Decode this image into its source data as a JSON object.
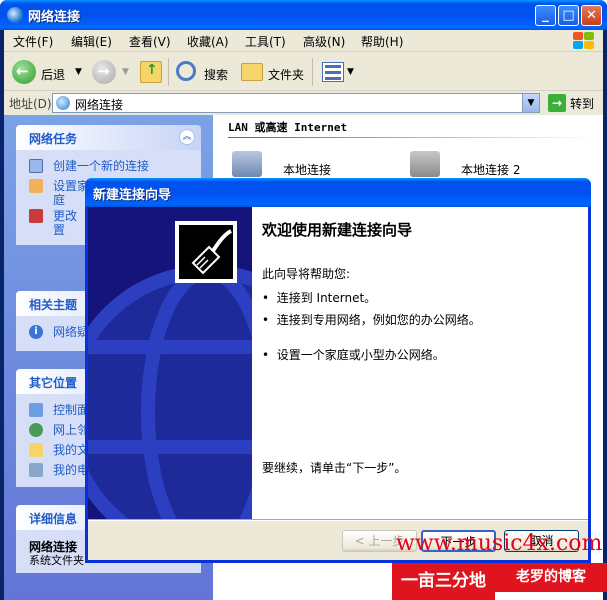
{
  "window": {
    "title": "网络连接"
  },
  "menus": [
    "文件(F)",
    "编辑(E)",
    "查看(V)",
    "收藏(A)",
    "工具(T)",
    "高级(N)",
    "帮助(H)"
  ],
  "toolbar": {
    "back": "后退",
    "search": "搜索",
    "folders": "文件夹"
  },
  "address": {
    "label": "地址(D)",
    "value": "网络连接",
    "go": "转到"
  },
  "section_header": "LAN 或高速 Internet",
  "connections": [
    "本地连接",
    "本地连接 2"
  ],
  "panels": {
    "tasks": {
      "title": "网络任务",
      "items": [
        "创建一个新的连接",
        "设置家",
        "庭",
        "更改",
        "置"
      ]
    },
    "related": {
      "title": "相关主题",
      "items": [
        "网络疑"
      ]
    },
    "other": {
      "title": "其它位置",
      "items": [
        "控制面",
        "网上邻",
        "我的文",
        "我的电"
      ]
    },
    "details": {
      "title": "详细信息",
      "name": "网络连接",
      "sub": "系统文件夹"
    }
  },
  "dialog": {
    "title": "新建连接向导",
    "heading": "欢迎使用新建连接向导",
    "intro": "此向导将帮助您:",
    "bullets": [
      "连接到 Internet。",
      "连接到专用网络，例如您的办公网络。",
      "设置一个家庭或小型办公网络。"
    ],
    "footer": "要继续，请单击“下一步”。",
    "back": "< 上一步",
    "next": "下一步",
    "cancel": "取消"
  },
  "watermark": {
    "url": "www.music4x.com",
    "left": "一亩三分地",
    "right": "老罗的博客"
  },
  "colors": {
    "titlebar": "#0053ee",
    "task_pane": "#6375d6",
    "dialog_art": "#14147a",
    "watermark": "#e0141e"
  }
}
